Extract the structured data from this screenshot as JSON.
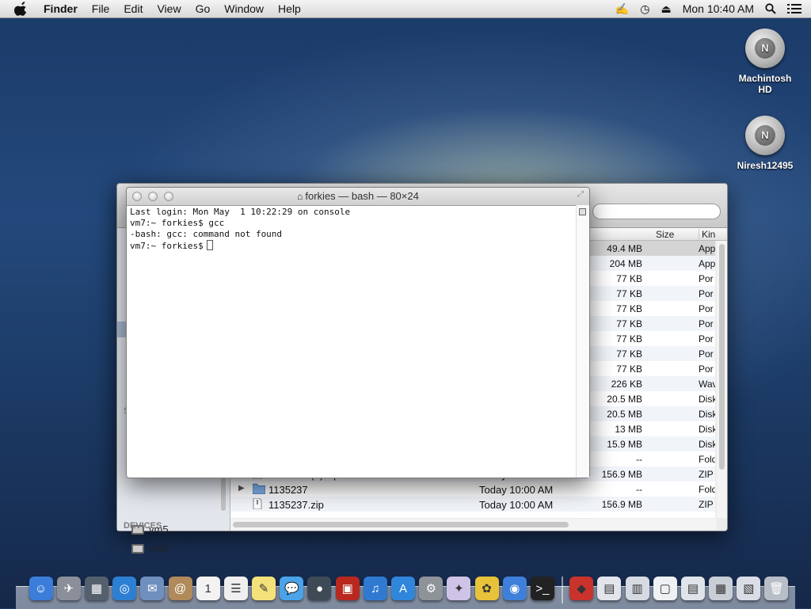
{
  "menubar": {
    "items": [
      "Finder",
      "File",
      "Edit",
      "View",
      "Go",
      "Window",
      "Help"
    ],
    "clock": "Mon 10:40 AM"
  },
  "desktop": {
    "icons": [
      {
        "label": "Machintosh HD",
        "glyph": "N"
      },
      {
        "label": "Niresh12495",
        "glyph": "N"
      }
    ]
  },
  "terminal": {
    "title": "forkies — bash — 80×24",
    "lines": [
      "Last login: Mon May  1 10:22:29 on console",
      "vm7:~ forkies$ gcc",
      "-bash: gcc: command not found",
      "vm7:~ forkies$"
    ]
  },
  "finder": {
    "columns": {
      "size": "Size",
      "kind": "Kin"
    },
    "sidebar": {
      "section_label": "S",
      "items": [
        "vm5",
        "vm6"
      ],
      "devices_label": "DEVICES"
    },
    "rows": [
      {
        "name": "",
        "date": "",
        "size": "49.4 MB",
        "kind": "App"
      },
      {
        "name": "",
        "date": "",
        "size": "204 MB",
        "kind": "App"
      },
      {
        "name": "",
        "date": "",
        "size": "77 KB",
        "kind": "Por"
      },
      {
        "name": "",
        "date": "",
        "size": "77 KB",
        "kind": "Por"
      },
      {
        "name": "",
        "date": "",
        "size": "77 KB",
        "kind": "Por"
      },
      {
        "name": "",
        "date": "",
        "size": "77 KB",
        "kind": "Por"
      },
      {
        "name": "",
        "date": "",
        "size": "77 KB",
        "kind": "Por"
      },
      {
        "name": "",
        "date": "",
        "size": "77 KB",
        "kind": "Por"
      },
      {
        "name": "",
        "date": "",
        "size": "77 KB",
        "kind": "Por"
      },
      {
        "name": "",
        "date": "",
        "size": "226 KB",
        "kind": "Wav"
      },
      {
        "name": "",
        "date": "",
        "size": "20.5 MB",
        "kind": "Disk"
      },
      {
        "name": "",
        "date": "",
        "size": "20.5 MB",
        "kind": "Disk"
      },
      {
        "name": "",
        "date": "",
        "size": "13 MB",
        "kind": "Disk"
      },
      {
        "name": "",
        "date": "",
        "size": "15.9 MB",
        "kind": "Disk"
      },
      {
        "name": "",
        "date": "",
        "size": "--",
        "kind": "Fold"
      },
      {
        "name": "1135237 (1).zip",
        "date": "Today 10:00 AM",
        "size": "156.9 MB",
        "kind": "ZIP"
      },
      {
        "name": "1135237",
        "date": "Today 10:00 AM",
        "size": "--",
        "kind": "Fold"
      },
      {
        "name": "1135237.zip",
        "date": "Today 10:00 AM",
        "size": "156.9 MB",
        "kind": "ZIP"
      }
    ]
  },
  "dock": {
    "apps": [
      {
        "name": "finder",
        "color": "#3b7dd8",
        "glyph": "☺"
      },
      {
        "name": "launchpad",
        "color": "#8a8f99",
        "glyph": "✈"
      },
      {
        "name": "mission-control",
        "color": "#55606e",
        "glyph": "▦"
      },
      {
        "name": "safari",
        "color": "#2d7fd3",
        "glyph": "◎"
      },
      {
        "name": "mail",
        "color": "#6f8fbf",
        "glyph": "✉"
      },
      {
        "name": "contacts",
        "color": "#b08a5a",
        "glyph": "@"
      },
      {
        "name": "calendar",
        "color": "#f2f2f2",
        "glyph": "1"
      },
      {
        "name": "reminders",
        "color": "#efefef",
        "glyph": "☰"
      },
      {
        "name": "notes",
        "color": "#f3e27a",
        "glyph": "✎"
      },
      {
        "name": "messages",
        "color": "#4aa2e8",
        "glyph": "💬"
      },
      {
        "name": "facetime",
        "color": "#3f4a57",
        "glyph": "●"
      },
      {
        "name": "photo-booth",
        "color": "#b8281f",
        "glyph": "▣"
      },
      {
        "name": "itunes",
        "color": "#2f7ad0",
        "glyph": "♫"
      },
      {
        "name": "app-store",
        "color": "#2f86db",
        "glyph": "A"
      },
      {
        "name": "system-preferences",
        "color": "#8e9399",
        "glyph": "⚙"
      },
      {
        "name": "unicorn",
        "color": "#cfc3e8",
        "glyph": "✦"
      },
      {
        "name": "cyberduck",
        "color": "#e7c23a",
        "glyph": "✿"
      },
      {
        "name": "chrome",
        "color": "#3e7fd9",
        "glyph": "◉"
      },
      {
        "name": "terminal",
        "color": "#222222",
        "glyph": ">_"
      }
    ],
    "docs": [
      {
        "name": "angry-birds",
        "color": "#c9332c",
        "glyph": "◆"
      },
      {
        "name": "doc-1",
        "color": "#e2e6ec",
        "glyph": "▤"
      },
      {
        "name": "doc-2",
        "color": "#d6dbe3",
        "glyph": "▥"
      },
      {
        "name": "doc-3",
        "color": "#eef0f3",
        "glyph": "▢"
      },
      {
        "name": "doc-4",
        "color": "#dfe3ea",
        "glyph": "▤"
      },
      {
        "name": "doc-5",
        "color": "#c9ced6",
        "glyph": "▦"
      },
      {
        "name": "doc-6",
        "color": "#d9dee6",
        "glyph": "▧"
      },
      {
        "name": "trash",
        "color": "#b8bec7",
        "glyph": "🗑"
      }
    ]
  }
}
